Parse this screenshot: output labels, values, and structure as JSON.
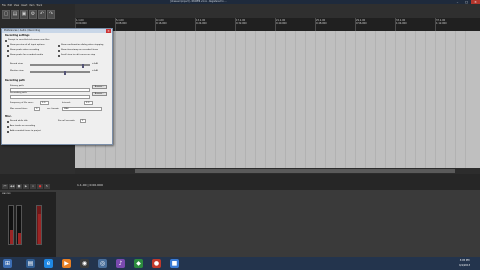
{
  "window": {
    "title": "[Unsaved project] - REAPER v4.xx - Registered to ...",
    "minimize": "–",
    "maximize": "□",
    "close": "✕"
  },
  "menu": [
    "File",
    "Edit",
    "View",
    "Insert",
    "Item",
    "Track",
    "Options",
    "Actions",
    "Extensions",
    "Help"
  ],
  "ruler": {
    "labels": [
      "1.1.00\n0:00.000",
      "5.1.00\n0:08.000",
      "9.1.00\n0:16.000",
      "13.1.00\n0:24.000",
      "17.1.00\n0:32.000",
      "21.1.00\n0:40.000",
      "25.1.00\n0:48.000",
      "29.1.00\n0:56.000",
      "33.1.00\n1:04.000",
      "37.1.00\n1:12.000"
    ]
  },
  "transport": {
    "time": "1.1.00 | 0:00.000",
    "buttons": [
      "⏮",
      "◀◀",
      "■",
      "▶",
      "⏸",
      "●",
      "↻"
    ]
  },
  "dialog": {
    "title": "Preferences / Audio / Recording",
    "close": "✕",
    "section_general": "Recording settings",
    "checks": [
      {
        "label": "Prompt to save/delete/rename new files",
        "on": true
      },
      {
        "label": "Show preview of all input options",
        "on": false
      },
      {
        "label": "Show confirmation dialog when stopping",
        "on": false
      },
      {
        "label": "Show peaks when recording",
        "on": false
      },
      {
        "label": "Show timestamp on recorded items",
        "on": false
      },
      {
        "label": "Show peaks for recorded media",
        "on": false
      },
      {
        "label": "Scroll view to edit cursor on stop",
        "on": false
      }
    ],
    "slider1": {
      "label": "Record view:",
      "value": "+0dB",
      "level": 0.85
    },
    "slider2": {
      "label": "Monitor view:",
      "value": "+0dB",
      "level": 0.55
    },
    "section_paths": "Recording path",
    "path_primary_label": "Primary path:",
    "path_secondary_label": "Secondary path:",
    "browse": "Browse...",
    "freq_label": "Frequency of file save:",
    "freq_value": "5.0",
    "interval_label": "Interval:",
    "interval_value": "5.0",
    "max_label": "Max record time:",
    "max_value": "0",
    "format_label": "rec. format:",
    "format_value": "WAV",
    "section_misc": "Misc.",
    "misc": [
      {
        "label": "Record while idle",
        "on": false
      },
      {
        "label": "Arm tracks on recording",
        "on": false
      },
      {
        "label": "Add recorded items to project",
        "on": true
      }
    ],
    "preroll_label": "Pre-roll seconds:",
    "preroll_value": "2"
  },
  "mixer": {
    "master_label": "MASTER"
  },
  "taskbar": {
    "time": "3:05 PM",
    "date": "6/1/2013"
  }
}
